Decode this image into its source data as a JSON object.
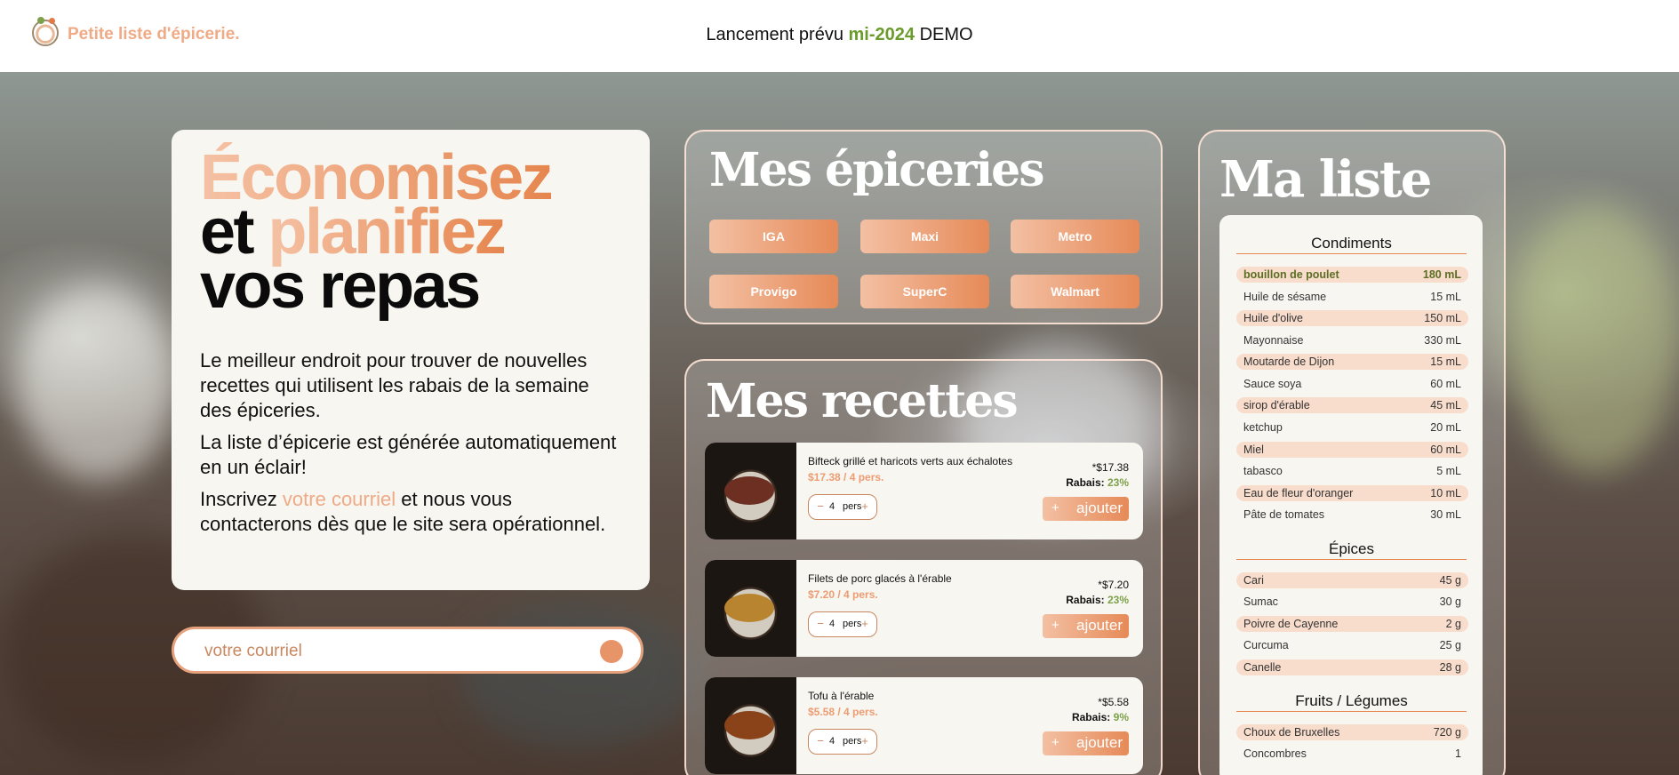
{
  "header": {
    "brand": "Petite liste d'épicerie.",
    "launch_prefix": "Lancement prévu",
    "launch_highlight": "mi-2024",
    "launch_suffix": "DEMO"
  },
  "hero": {
    "line1": "Économisez",
    "line2_a": "et",
    "line2_b": "planifiez",
    "line3": "vos repas",
    "p1": "Le meilleur endroit pour trouver de nouvelles recettes qui utilisent les rabais de la semaine des épiceries.",
    "p2": "La liste d’épicerie est générée automatiquement en un éclair!",
    "p3_a": "Inscrivez",
    "p3_link": "votre courriel",
    "p3_b": "et nous vous contacterons dès que le site sera opérationnel."
  },
  "email": {
    "placeholder": "votre courriel"
  },
  "stores": {
    "title": "Mes épiceries",
    "items": [
      "IGA",
      "Maxi",
      "Metro",
      "Provigo",
      "SuperC",
      "Walmart"
    ]
  },
  "recipes": {
    "title": "Mes recettes",
    "unit": "pers",
    "add_label": "ajouter",
    "rebate_label": "Rabais:",
    "items": [
      {
        "name": "Bifteck grillé et haricots verts aux échalotes",
        "price": "$17.38 / 4 pers.",
        "total": "*$17.38",
        "rebate": "23%",
        "servings": "4"
      },
      {
        "name": "Filets de porc glacés à l'érable",
        "price": "$7.20 / 4 pers.",
        "total": "*$7.20",
        "rebate": "23%",
        "servings": "4"
      },
      {
        "name": "Tofu à l'érable",
        "price": "$5.58 / 4 pers.",
        "total": "*$5.58",
        "rebate": "9%",
        "servings": "4"
      }
    ]
  },
  "mylist": {
    "title": "Ma liste",
    "categories": [
      {
        "name": "Condiments",
        "items": [
          {
            "name": "bouillon de poulet",
            "qty": "180 mL"
          },
          {
            "name": "Huile de sésame",
            "qty": "15 mL"
          },
          {
            "name": "Huile d'olive",
            "qty": "150 mL"
          },
          {
            "name": "Mayonnaise",
            "qty": "330 mL"
          },
          {
            "name": "Moutarde de Dijon",
            "qty": "15 mL"
          },
          {
            "name": "Sauce soya",
            "qty": "60 mL"
          },
          {
            "name": "sirop d'érable",
            "qty": "45 mL"
          },
          {
            "name": "ketchup",
            "qty": "20 mL"
          },
          {
            "name": "Miel",
            "qty": "60 mL"
          },
          {
            "name": "tabasco",
            "qty": "5 mL"
          },
          {
            "name": "Eau de fleur d'oranger",
            "qty": "10 mL"
          },
          {
            "name": "Pâte de tomates",
            "qty": "30 mL"
          }
        ]
      },
      {
        "name": "Épices",
        "items": [
          {
            "name": "Cari",
            "qty": "45 g"
          },
          {
            "name": "Sumac",
            "qty": "30 g"
          },
          {
            "name": "Poivre de Cayenne",
            "qty": "2 g"
          },
          {
            "name": "Curcuma",
            "qty": "25 g"
          },
          {
            "name": "Canelle",
            "qty": "28 g"
          }
        ]
      },
      {
        "name": "Fruits / Légumes",
        "items": [
          {
            "name": "Choux de Bruxelles",
            "qty": "720 g"
          },
          {
            "name": "Concombres",
            "qty": "1"
          }
        ]
      }
    ]
  },
  "colors": {
    "accent": "#e6864f",
    "accent_light": "#f3c0a3",
    "green": "#6b9b2c",
    "card": "#f7f6f1"
  }
}
